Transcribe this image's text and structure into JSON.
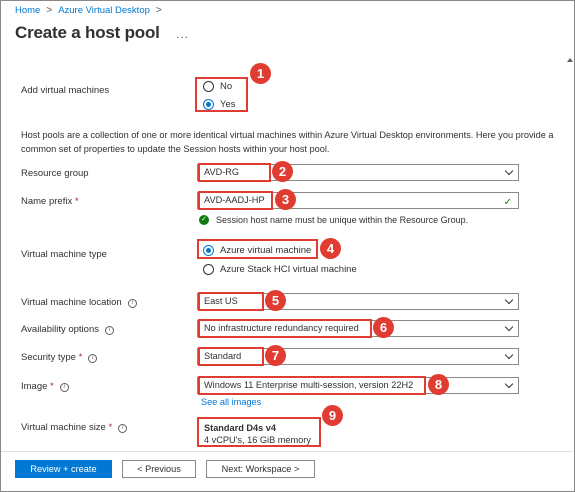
{
  "breadcrumb": {
    "home": "Home",
    "parent": "Azure Virtual Desktop",
    "separator": ">"
  },
  "page": {
    "title": "Create a host pool",
    "more": "..."
  },
  "fields": {
    "add_vms": {
      "label": "Add virtual machines",
      "options": [
        "No",
        "Yes"
      ],
      "selected": "Yes"
    },
    "description": "Host pools are a collection of one or more identical virtual machines within Azure Virtual Desktop environments. Here you provide a common set of properties to update the Session hosts within your host pool.",
    "resource_group": {
      "label": "Resource group",
      "value": "AVD-RG"
    },
    "name_prefix": {
      "label": "Name prefix",
      "required": "*",
      "value": "AVD-AADJ-HP",
      "validation": "Session host name must be unique within the Resource Group."
    },
    "vm_type": {
      "label": "Virtual machine type",
      "options": [
        "Azure virtual machine",
        "Azure Stack HCI virtual machine"
      ],
      "selected": "Azure virtual machine"
    },
    "vm_location": {
      "label": "Virtual machine location",
      "value": "East US"
    },
    "availability": {
      "label": "Availability options",
      "value": "No infrastructure redundancy required"
    },
    "security_type": {
      "label": "Security type",
      "required": "*",
      "value": "Standard"
    },
    "image": {
      "label": "Image",
      "required": "*",
      "value": "Windows 11 Enterprise multi-session, version 22H2",
      "link": "See all images"
    },
    "vm_size": {
      "label": "Virtual machine size",
      "required": "*",
      "name": "Standard D4s v4",
      "detail": "4 vCPU's, 16 GiB memory"
    }
  },
  "badges": [
    "1",
    "2",
    "3",
    "4",
    "5",
    "6",
    "7",
    "8",
    "9"
  ],
  "footer": {
    "review_create": "Review + create",
    "previous": "< Previous",
    "next": "Next: Workspace >"
  },
  "colors": {
    "accent": "#0078d4",
    "highlight": "#e03c31",
    "success": "#107c10"
  }
}
